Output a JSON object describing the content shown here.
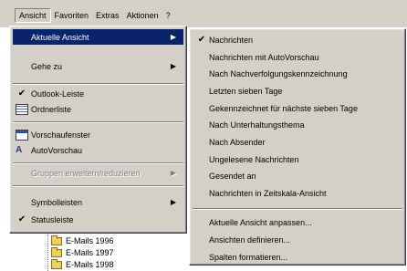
{
  "menubar": {
    "items": [
      "Ansicht",
      "Favoriten",
      "Extras",
      "Aktionen",
      "?"
    ]
  },
  "view_menu": {
    "items": [
      {
        "label": "Aktuelle Ansicht",
        "submenu": true,
        "highlighted": true
      },
      {
        "label": "Gehe zu",
        "submenu": true
      },
      {
        "label": "Outlook-Leiste",
        "checked": true
      },
      {
        "label": "Ordnerliste",
        "icon": "folder-list-icon"
      },
      {
        "label": "Vorschaufenster",
        "icon": "preview-pane-icon"
      },
      {
        "label": "AutoVorschau",
        "icon": "autopreview-icon"
      },
      {
        "label": "Gruppen erweitern/reduzieren",
        "submenu": true,
        "disabled": true
      },
      {
        "label": "Symbolleisten",
        "submenu": true
      },
      {
        "label": "Statusleiste",
        "checked": true
      }
    ]
  },
  "current_view_submenu": {
    "items": [
      {
        "label": "Nachrichten",
        "checked": true
      },
      {
        "label": "Nachrichten mit AutoVorschau"
      },
      {
        "label": "Nach Nachverfolgungskennzeichnung"
      },
      {
        "label": "Letzten sieben Tage"
      },
      {
        "label": "Gekennzeichnet für nächste sieben Tage"
      },
      {
        "label": "Nach Unterhaltungsthema"
      },
      {
        "label": "Nach Absender"
      },
      {
        "label": "Ungelesene Nachrichten"
      },
      {
        "label": "Gesendet an"
      },
      {
        "label": "Nachrichten in Zeitskala-Ansicht"
      },
      {
        "label": "Aktuelle Ansicht anpassen..."
      },
      {
        "label": "Ansichten definieren..."
      },
      {
        "label": "Spalten formatieren..."
      }
    ]
  },
  "folder_tree": {
    "items": [
      "E-Mails 1996",
      "E-Mails 1997",
      "E-Mails 1998"
    ]
  }
}
